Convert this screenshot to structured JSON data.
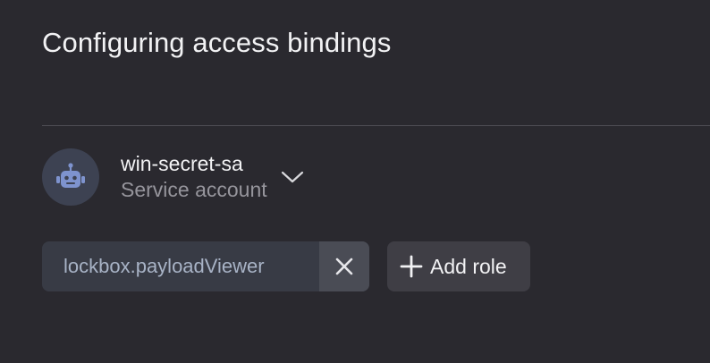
{
  "dialog": {
    "title": "Configuring access bindings"
  },
  "subject": {
    "name": "win-secret-sa",
    "type": "Service account",
    "avatar_icon": "robot-icon",
    "toggle_icon": "chevron-down-icon"
  },
  "roles": [
    {
      "label": "lockbox.payloadViewer",
      "remove_icon": "close-icon"
    }
  ],
  "add_role": {
    "label": "Add role",
    "icon": "plus-icon"
  },
  "colors": {
    "background": "#2a292f",
    "avatar_bg": "#3d4252",
    "robot": "#7e93ce",
    "chip_bg": "#383b45",
    "chip_text": "#a8b3c6",
    "button_bg": "#3f3e45",
    "secondary_text": "#96959c"
  }
}
